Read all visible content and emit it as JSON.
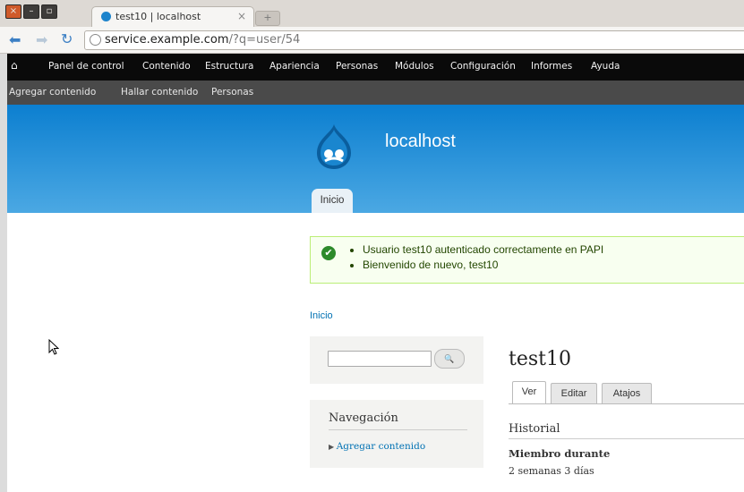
{
  "browser": {
    "tab_title": "test10 | localhost",
    "tab_close": "×",
    "new_tab": "+",
    "url_host": "service.example.com",
    "url_path": "/?q=user/54",
    "window_buttons": [
      "×",
      "–",
      "▫"
    ]
  },
  "admin_toolbar": {
    "home_icon": "home-icon",
    "items": [
      "Panel de control",
      "Contenido",
      "Estructura",
      "Apariencia",
      "Personas",
      "Módulos",
      "Configuración",
      "Informes",
      "Ayuda"
    ]
  },
  "shortcuts": {
    "items": [
      "Agregar contenido",
      "Hallar contenido",
      "Personas"
    ]
  },
  "header": {
    "site_name": "localhost",
    "main_tab": "Inicio"
  },
  "messages": {
    "items": [
      "Usuario test10 autenticado correctamente en PAPI",
      "Bienvenido de nuevo, test10"
    ]
  },
  "breadcrumb": "Inicio",
  "sidebar": {
    "search_button": "🔍",
    "nav_title": "Navegación",
    "nav_link": "Agregar contenido"
  },
  "main": {
    "title": "test10",
    "tabs": [
      "Ver",
      "Editar",
      "Atajos"
    ],
    "history_title": "Historial",
    "member_label": "Miembro durante",
    "member_value": "2 semanas 3 días"
  }
}
